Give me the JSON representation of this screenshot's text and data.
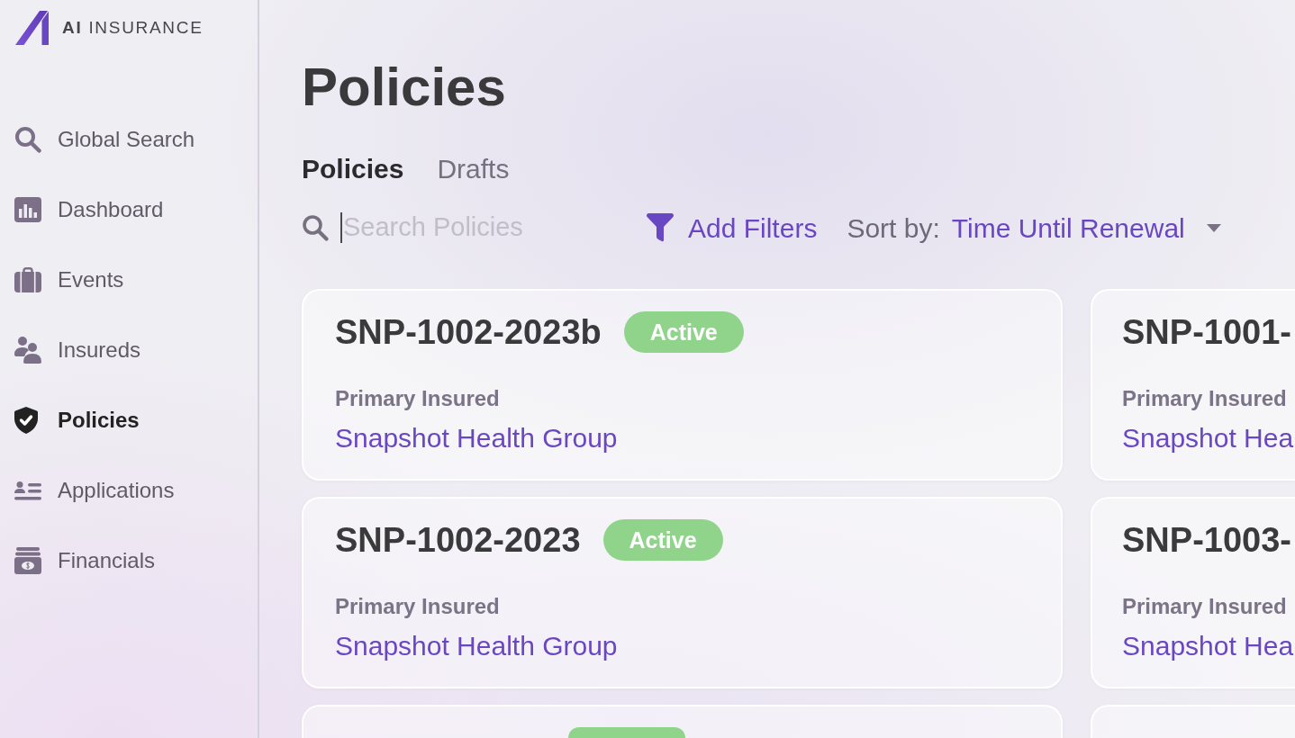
{
  "sidebar": {
    "logo": {
      "text": "**AI** INSURANCE"
    },
    "items": [
      {
        "label": "Global Search",
        "selected": false
      },
      {
        "label": "Dashboard",
        "selected": false
      },
      {
        "label": "Events",
        "selected": false
      },
      {
        "label": "Insureds",
        "selected": false
      },
      {
        "label": "Policies",
        "selected": true
      },
      {
        "label": "Applications",
        "selected": false
      },
      {
        "label": "Financials",
        "selected": false
      }
    ]
  },
  "page": {
    "title": "Policies"
  },
  "tabs": [
    {
      "label": "Policies",
      "selected": true
    },
    {
      "label": "Drafts",
      "selected": false
    }
  ],
  "toolbar": {
    "search": {
      "placeholder": "Search Policies",
      "focused": true
    },
    "filters_button": "Add Filters",
    "sort": {
      "label": "Sort by:",
      "value": "Time Until Renewal"
    }
  },
  "policies": [
    {
      "number": "SNP-1002-2023b",
      "status": "Active",
      "insured_label": "Primary Insured",
      "insured": "Snapshot Health Group"
    },
    {
      "number": "SNP-1001-",
      "insured_label": "Primary Insured",
      "insured": "Snapshot Hea"
    },
    {
      "number": "SNP-1002-2023",
      "status": "Active",
      "insured_label": "Primary Insured",
      "insured": "Snapshot Health Group"
    },
    {
      "number": "SNP-1003-",
      "insured_label": "Primary Insured",
      "insured": "Snapshot Hea"
    }
  ],
  "next_row": [
    {
      "badge": true
    },
    {
      "badge": false
    }
  ]
}
